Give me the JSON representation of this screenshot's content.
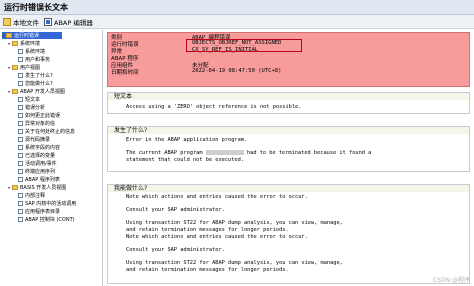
{
  "window": {
    "title": "运行时错误长文本"
  },
  "toolbar": {
    "local_file": "本地文件",
    "abap_editor": "ABAP 编辑器"
  },
  "tree": [
    {
      "label": "运行时错误",
      "expanded": true,
      "type": "folder",
      "selected": true
    },
    {
      "label": "系统环境",
      "expanded": true,
      "type": "folder"
    },
    {
      "label": "系统环境",
      "type": "doc"
    },
    {
      "label": "用户和事务",
      "type": "doc"
    },
    {
      "label": "用户视图",
      "expanded": true,
      "type": "folder"
    },
    {
      "label": "发生了什么?",
      "type": "doc"
    },
    {
      "label": "您能做什么?",
      "type": "doc"
    },
    {
      "label": "ABAP 开发人员视图",
      "expanded": true,
      "type": "folder"
    },
    {
      "label": "短文本",
      "type": "doc"
    },
    {
      "label": "错误分析",
      "type": "doc"
    },
    {
      "label": "如何更正此错误",
      "type": "doc"
    },
    {
      "label": "异常对象的信",
      "type": "doc"
    },
    {
      "label": "关于在何处终止的信息",
      "type": "doc"
    },
    {
      "label": "源代码摘录",
      "type": "doc"
    },
    {
      "label": "系统字段的内容",
      "type": "doc"
    },
    {
      "label": "已选择的变量",
      "type": "doc"
    },
    {
      "label": "活动调用/事件",
      "type": "doc"
    },
    {
      "label": "终端应用序列",
      "type": "doc"
    },
    {
      "label": "ABAP 程序列表",
      "type": "doc"
    },
    {
      "label": "BASIS 开发人员视图",
      "expanded": true,
      "type": "folder"
    },
    {
      "label": "内部注释",
      "type": "doc"
    },
    {
      "label": "SAP 内核中的活动调用",
      "type": "doc"
    },
    {
      "label": "应用程序表目录",
      "type": "doc"
    },
    {
      "label": "ABAP 控制块 (CONT)",
      "type": "doc"
    }
  ],
  "header": {
    "rows": [
      {
        "key": "类别",
        "value": "ABAP 编程错误"
      },
      {
        "key": "运行时错误",
        "value": "OBJECTS_OBJREF_NOT_ASSIGNED"
      },
      {
        "key": "异常",
        "value": "CX_SY_REF_IS_INITIAL"
      },
      {
        "key": "ABAP 程序",
        "value": ""
      },
      {
        "key": "应用组件",
        "value": "未分配"
      },
      {
        "key": "日期和时间",
        "value": "2022-04-19 08:47:50 (UTC+8)"
      }
    ]
  },
  "sections": [
    {
      "title": "短文本",
      "lines": [
        "Access using a 'ZERO' object reference is not possible."
      ]
    },
    {
      "title": "发生了什么?",
      "lines": [
        "Error in the ABAP application program.",
        "",
        "The current ABAP program",
        "had to be terminated because it found a",
        "statement that could not be executed."
      ]
    },
    {
      "title": "我能做什么?",
      "lines": [
        "Note which actions and entries caused the error to occur.",
        "",
        "Consult your SAP administrator.",
        "",
        "Using transaction ST22 for ABAP dump analysis, you can view, manage,",
        "and retain termination messages for longer periods.",
        "Note which actions and entries caused the error to occur.",
        "",
        "Consult your SAP administrator.",
        "",
        "Using transaction ST22 for ABAP dump analysis, you can view, manage,",
        "and retain termination messages for longer periods."
      ]
    }
  ],
  "watermark": "CSDN @程序"
}
